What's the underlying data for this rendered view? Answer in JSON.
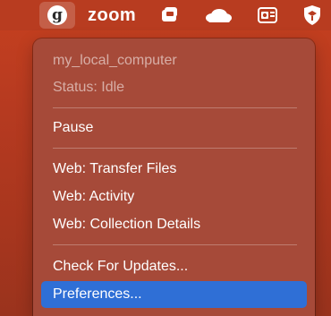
{
  "menubar": {
    "active_app_glyph": "g",
    "zoom_label": "zoom",
    "icons": [
      "globus-connect-icon",
      "zoom-icon",
      "app-icon",
      "cloud-icon",
      "outlook-icon",
      "shield-icon"
    ]
  },
  "menu": {
    "computer_name": "my_local_computer",
    "status": "Status: Idle",
    "pause": "Pause",
    "web_transfer": "Web: Transfer Files",
    "web_activity": "Web: Activity",
    "web_collection": "Web: Collection Details",
    "check_updates": "Check For Updates...",
    "preferences": "Preferences..."
  },
  "colors": {
    "menubar": "#b83c20",
    "menu_bg": "#a64a39",
    "highlight": "#2f6fd6"
  }
}
